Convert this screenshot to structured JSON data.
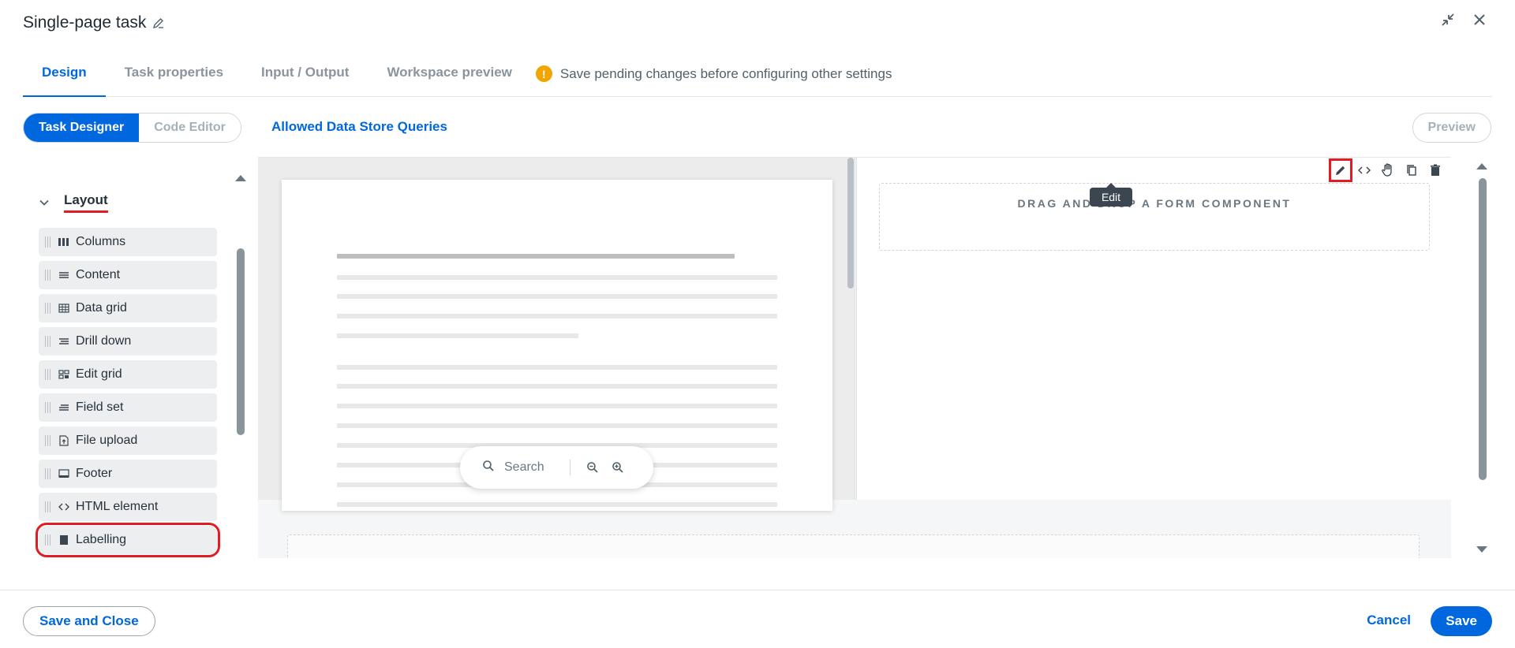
{
  "header": {
    "title": "Single-page task"
  },
  "tabs": [
    {
      "label": "Design",
      "active": true
    },
    {
      "label": "Task properties",
      "active": false
    },
    {
      "label": "Input / Output",
      "active": false
    },
    {
      "label": "Workspace preview",
      "active": false
    }
  ],
  "notice": {
    "icon_symbol": "!",
    "text": "Save pending changes before configuring other settings"
  },
  "toolbar": {
    "task_designer": "Task Designer",
    "code_editor": "Code Editor",
    "allowed_queries": "Allowed Data Store Queries",
    "preview": "Preview"
  },
  "palette": {
    "section": "Layout",
    "items": [
      {
        "label": "Columns",
        "icon": "columns-icon"
      },
      {
        "label": "Content",
        "icon": "content-icon"
      },
      {
        "label": "Data grid",
        "icon": "data-grid-icon"
      },
      {
        "label": "Drill down",
        "icon": "drill-down-icon"
      },
      {
        "label": "Edit grid",
        "icon": "edit-grid-icon"
      },
      {
        "label": "Field set",
        "icon": "field-set-icon"
      },
      {
        "label": "File upload",
        "icon": "file-upload-icon"
      },
      {
        "label": "Footer",
        "icon": "footer-icon"
      },
      {
        "label": "HTML element",
        "icon": "html-element-icon"
      },
      {
        "label": "Labelling",
        "icon": "labelling-icon"
      }
    ]
  },
  "document_viewer": {
    "search_label": "Search"
  },
  "form": {
    "drop_zone_text": "DRAG AND DROP A FORM COMPONENT",
    "tooltip": "Edit"
  },
  "footer": {
    "save_and_close": "Save and Close",
    "cancel": "Cancel",
    "save": "Save"
  },
  "colors": {
    "primary": "#0067df",
    "annotation": "#e31b23",
    "warning": "#f0a500"
  }
}
